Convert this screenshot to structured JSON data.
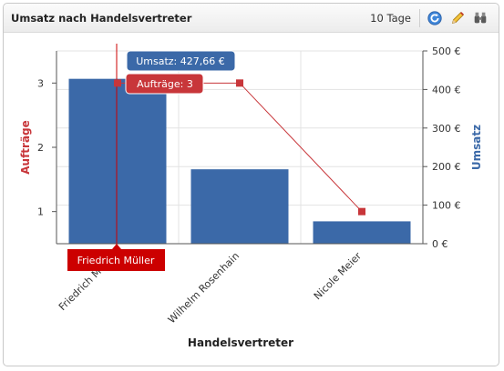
{
  "widget": {
    "title": "Umsatz nach Handelsvertreter",
    "period": "10 Tage",
    "toolbar": [
      {
        "name": "refresh-icon"
      },
      {
        "name": "edit-pencil-icon"
      },
      {
        "name": "binoculars-icon"
      }
    ]
  },
  "colors": {
    "bar": "#3b69a8",
    "line": "#c8363a",
    "tooltip_umsatz": "#3b69a8",
    "tooltip_auftraege": "#c8363a",
    "crosshair_label": "#cc0000"
  },
  "chart_data": {
    "type": "bar",
    "categories": [
      "Friedrich Müller",
      "Wilhelm Rosenhain",
      "Nicole Meier"
    ],
    "xlabel": "Handelsvertreter",
    "series": [
      {
        "name": "Umsatz",
        "type": "bar",
        "axis": "right",
        "values": [
          427.66,
          193,
          58
        ]
      },
      {
        "name": "Aufträge",
        "type": "line",
        "axis": "left",
        "values": [
          3,
          3,
          1
        ]
      }
    ],
    "y_left": {
      "label": "Aufträge",
      "ticks": [
        "1",
        "2",
        "3"
      ],
      "range": [
        0.5,
        3.5
      ]
    },
    "y_right": {
      "label": "Umsatz",
      "ticks": [
        "0 €",
        "100 €",
        "200 €",
        "300 €",
        "400 €",
        "500 €"
      ],
      "range": [
        0,
        500
      ]
    },
    "grid": true,
    "tooltips": {
      "umsatz": "Umsatz: 427,66 €",
      "auftraege": "Aufträge: 3"
    },
    "crosshair_label": "Friedrich Müller"
  }
}
